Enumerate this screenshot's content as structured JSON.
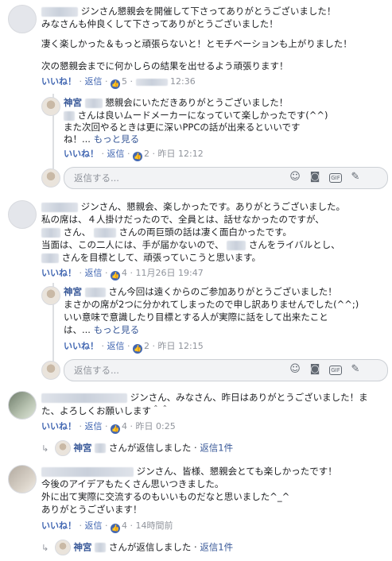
{
  "ui": {
    "like": "いいね！",
    "reply": "返信",
    "dot": "·",
    "more": "もっと見る",
    "reply_placeholder": "返信する...",
    "replied_suffix": "さんが返信しました",
    "reply_count": "返信1件",
    "author_reply_name": "神宮"
  },
  "comments": [
    {
      "lines": [
        "ジンさん懇親会を開催して下さってありがとうございました！",
        "みなさんも仲良くして下さってありがとうございました！",
        "凄く楽しかった＆もっと頑張らないと！とモチベーションも上がりました！",
        "次の懇親会までに何かしらの結果を出せるよう頑張ります！"
      ],
      "likes": "5",
      "time": "12:36",
      "reply": {
        "name": "神宮",
        "lines": [
          "懇親会にいただきありがとうございました！",
          "さんは良いムードメーカーになっていて楽しかったです(^^)",
          "また次回やるときは更に深いPPCの話が出来るといいです",
          "ね！..."
        ],
        "likes": "2",
        "time": "昨日 12:12"
      }
    },
    {
      "lines": [
        "ジンさん、懇親会、楽しかったです。ありがとうございました。",
        "私の席は、４人掛けだったので、全員とは、話せなかったのですが、",
        "さん、",
        "さんの両巨頭の話は凄く面白かったです。",
        "当面は、この二人には、手が届かないので、",
        "さんをライバルとし、",
        "さんを目標として、頑張っていこうと思います。"
      ],
      "likes": "4",
      "time": "11月26日 19:47",
      "reply": {
        "name": "神宮",
        "lines": [
          "さん今回は遠くからのご参加ありがとうございました！",
          "まさかの席が2つに分かれてしまったので申し訳ありませんでした(^^;)",
          "いい意味で意識したり目標とする人が実際に話をして出来たこと",
          "は、..."
        ],
        "likes": "2",
        "time": "昨日 12:15"
      }
    },
    {
      "lines": [
        "ジンさん、みなさん、昨日はありがとうございました！ま",
        "た、よろしくお願いします＾＾"
      ],
      "likes": "4",
      "time": "昨日 0:25"
    },
    {
      "lines": [
        "ジンさん、皆様、懇親会とても楽しかったです！",
        "今後のアイデアもたくさん思いつきました。",
        "外に出て実際に交流するのもいいものだなと思いました^_^",
        "ありがとうございます！"
      ],
      "likes": "4",
      "time": "14時間前"
    }
  ]
}
